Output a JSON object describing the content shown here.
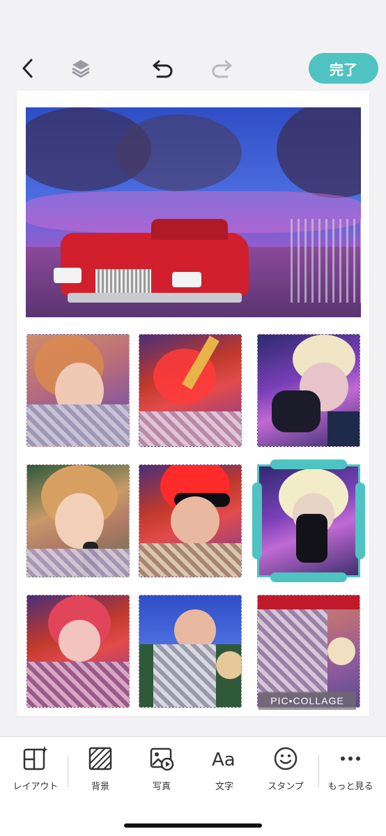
{
  "toolbar": {
    "done_label": "完了",
    "back_icon": "chevron-left-icon",
    "layers_icon": "layers-icon",
    "undo_icon": "undo-icon",
    "redo_icon": "redo-icon",
    "accent": "#4fc3c1"
  },
  "canvas": {
    "background": "#ffffff",
    "photo_count": 10,
    "selected_photo": 6,
    "watermark": "PIC•COLLAGE"
  },
  "bottom_tools": [
    {
      "label": "レイアウト",
      "icon": "layout-sparkle-icon"
    },
    {
      "label": "背景",
      "icon": "background-pattern-icon"
    },
    {
      "label": "写真",
      "icon": "photo-icon"
    },
    {
      "label": "文字",
      "icon": "text-aa-icon"
    },
    {
      "label": "スタンプ",
      "icon": "sticker-smiley-icon"
    },
    {
      "label": "もっと見る",
      "icon": "more-dots-icon"
    }
  ]
}
